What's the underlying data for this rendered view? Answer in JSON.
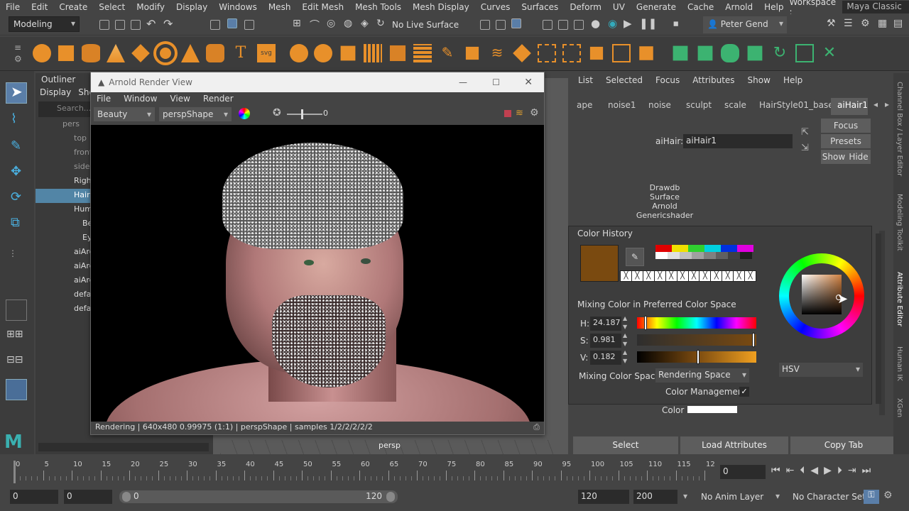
{
  "menubar": {
    "items": [
      "File",
      "Edit",
      "Create",
      "Select",
      "Modify",
      "Display",
      "Windows",
      "Mesh",
      "Edit Mesh",
      "Mesh Tools",
      "Mesh Display",
      "Curves",
      "Surfaces",
      "Deform",
      "UV",
      "Generate",
      "Cache",
      "Arnold",
      "Help"
    ],
    "workspace_label": "Workspace :",
    "workspace_value": "Maya Classic"
  },
  "statusline": {
    "mode": "Modeling",
    "live_surface": "No Live Surface",
    "user": "Peter Gend"
  },
  "outliner": {
    "title": "Outliner",
    "menus": [
      "Display",
      "Sho"
    ],
    "search_placeholder": "Search...",
    "items": [
      "pers",
      "top",
      "front",
      "side",
      "Righ",
      "Hair",
      "Hum",
      "Be",
      "Ey",
      "aiAre",
      "aiAre",
      "aiAre",
      "defa",
      "defa"
    ]
  },
  "render_view": {
    "title": "Arnold Render View",
    "menus": [
      "File",
      "Window",
      "View",
      "Render"
    ],
    "aov": "Beauty",
    "camera": "perspShape",
    "exposure": "0",
    "status": "Rendering | 640x480 0.99975 (1:1) | perspShape  | samples 1/2/2/2/2/2"
  },
  "viewport": {
    "camera_label": "persp"
  },
  "attribute_editor": {
    "menus": [
      "List",
      "Selected",
      "Focus",
      "Attributes",
      "Show",
      "Help"
    ],
    "tabs": [
      "ape",
      "noise1",
      "noise",
      "sculpt",
      "scale",
      "HairStyle01_base",
      "aiHair1"
    ],
    "node_label": "aiHair:",
    "node_value": "aiHair1",
    "buttons": {
      "focus": "Focus",
      "presets": "Presets",
      "show": "Show",
      "hide": "Hide"
    },
    "classifications": [
      "Drawdb",
      "Surface",
      "Arnold",
      "Genericshader"
    ],
    "color_label": "Color",
    "bottom_buttons": {
      "select": "Select",
      "load": "Load Attributes",
      "copy": "Copy Tab"
    }
  },
  "color_picker": {
    "history_title": "Color History",
    "mixing_title": "Mixing Color in Preferred Color Space",
    "h_label": "H:",
    "h_value": "24.187",
    "s_label": "S:",
    "s_value": "0.981",
    "v_label": "V:",
    "v_value": "0.182",
    "mix_space_label": "Mixing Color Space:",
    "mix_space_value": "Rendering Space",
    "cm_label": "Color Management",
    "model": "HSV",
    "current_color": "#7a4a10",
    "swatches_top": [
      "#e00000",
      "#f0e000",
      "#30d030",
      "#00d0e0",
      "#0030e0",
      "#e000e0"
    ],
    "swatches_bottom": [
      "#ffffff",
      "#e0e0e0",
      "#c0c0c0",
      "#a0a0a0",
      "#808080",
      "#606060",
      "#404040",
      "#202020"
    ]
  },
  "right_tabs": [
    "Channel Box / Layer Editor",
    "Modeling Toolkit",
    "Attribute Editor",
    "Human IK",
    "XGen"
  ],
  "timeline": {
    "ticks": [
      "0",
      "5",
      "10",
      "15",
      "20",
      "25",
      "30",
      "35",
      "40",
      "45",
      "50",
      "55",
      "60",
      "65",
      "70",
      "75",
      "80",
      "85",
      "90",
      "95",
      "100",
      "105",
      "110",
      "115",
      "12"
    ],
    "current_frame": "0"
  },
  "range": {
    "start": "0",
    "start2": "0",
    "slider_start": "0",
    "slider_end": "120",
    "end": "120",
    "end2": "200",
    "anim_layer": "No Anim Layer",
    "char_set": "No Character Set"
  }
}
